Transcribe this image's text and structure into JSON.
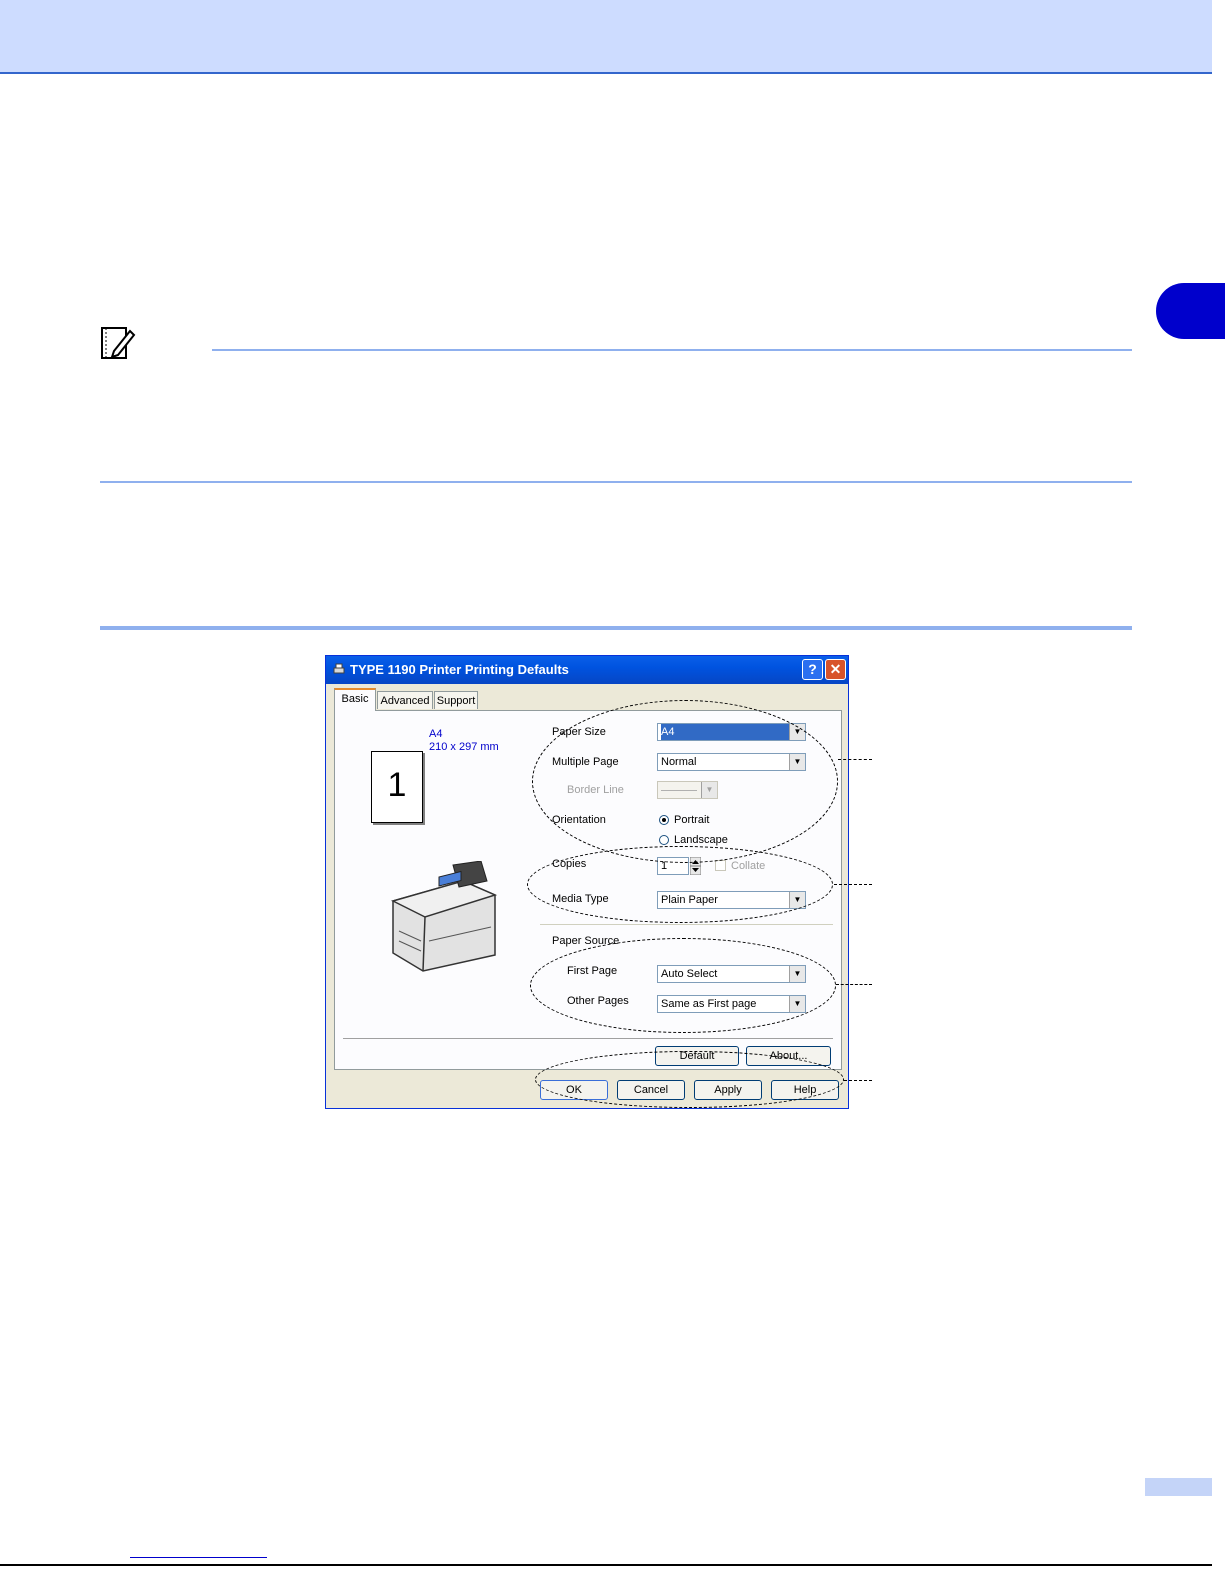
{
  "dialog": {
    "title": "TYPE 1190 Printer Printing Defaults",
    "help_btn": "?",
    "close_btn": "✕",
    "tabs": [
      "Basic",
      "Advanced",
      "Support"
    ],
    "preview": {
      "page_number": "1",
      "size_name": "A4",
      "size_dims": "210 x 297 mm"
    },
    "labels": {
      "paper_size": "Paper Size",
      "multiple_page": "Multiple Page",
      "border_line": "Border Line",
      "orientation": "Orientation",
      "portrait": "Portrait",
      "landscape": "Landscape",
      "copies": "Copies",
      "collate": "Collate",
      "media_type": "Media Type",
      "paper_source": "Paper Source",
      "first_page": "First Page",
      "other_pages": "Other Pages"
    },
    "values": {
      "paper_size": "A4",
      "multiple_page": "Normal",
      "copies": "1",
      "media_type": "Plain Paper",
      "first_page": "Auto Select",
      "other_pages": "Same as First page"
    },
    "buttons": {
      "default": "Default",
      "about": "About...",
      "ok": "OK",
      "cancel": "Cancel",
      "apply": "Apply",
      "help": "Help"
    }
  },
  "colors": {
    "header_band": "#cddcff",
    "chapter_tab": "#0000cc",
    "rule": "#8fb0ee"
  }
}
